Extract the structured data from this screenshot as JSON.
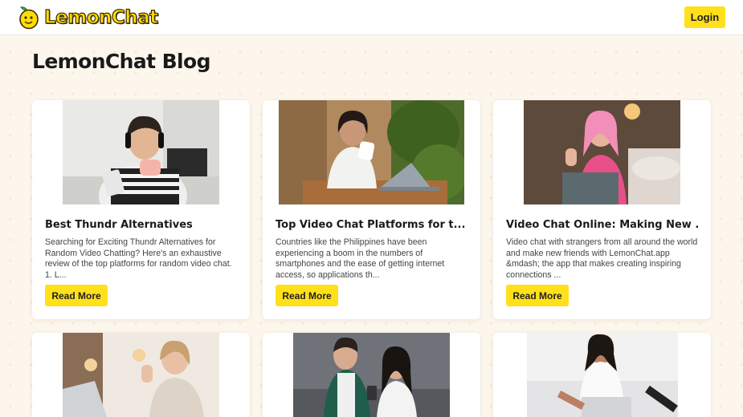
{
  "header": {
    "logo_text": "LemonChat",
    "login_label": "Login"
  },
  "page": {
    "title": "LemonChat Blog"
  },
  "colors": {
    "accent": "#ffe01b",
    "background": "#fdf6ec",
    "card": "#ffffff"
  },
  "posts": [
    {
      "title": "Best Thundr Alternatives",
      "excerpt": "Searching for Exciting Thundr Alternatives for Random Video Chatting? Here's an exhaustive review of the top platforms for random video chat. 1. L...",
      "button": "Read More",
      "image": "woman-with-headphones-photo"
    },
    {
      "title": "Top Video Chat Platforms for t...",
      "excerpt": "Countries like the Philippines have been experiencing a boom in the numbers of smartphones and the ease of getting internet access, so applications th...",
      "button": "Read More",
      "image": "woman-at-laptop-photo"
    },
    {
      "title": "Video Chat Online: Making New ...",
      "excerpt": "Video chat with strangers from all around the world and make new friends with LemonChat.app &mdash; the app that makes creating inspiring connections ...",
      "button": "Read More",
      "image": "pink-haired-woman-waving-photo"
    },
    {
      "image": "woman-waving-at-laptop-photo"
    },
    {
      "image": "couple-with-phone-photo"
    },
    {
      "image": "woman-on-bed-with-laptop-photo"
    }
  ]
}
